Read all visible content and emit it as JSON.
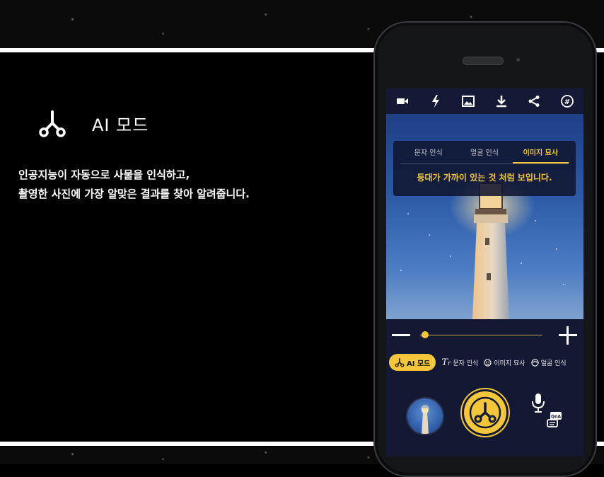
{
  "left_panel": {
    "mode_icon": "ai-mode-icon",
    "mode_title": "AI 모드",
    "description_lines": [
      "인공지능이 자동으로 사물을 인식하고,",
      "촬영한 사진에 가장 알맞은 결과를 찾아 알려줍니다."
    ]
  },
  "phone": {
    "toolbar_icons": [
      "video-camera-icon",
      "flash-icon",
      "gallery-icon",
      "download-icon",
      "share-icon",
      "hashtag-icon"
    ],
    "recognition_tabs": [
      {
        "label": "문자 인식",
        "active": false
      },
      {
        "label": "얼굴 인식",
        "active": false
      },
      {
        "label": "이미지 묘사",
        "active": true
      }
    ],
    "caption": "등대가 가까이 있는 것 처럼 보입니다.",
    "zoom_level": 0.04,
    "modes": [
      {
        "label": "AI 모드",
        "icon": "ai-mode-icon",
        "active": true
      },
      {
        "label": "문자 인식",
        "icon": "text-recognition-icon",
        "active": false
      },
      {
        "label": "이미지 묘사",
        "icon": "image-description-icon",
        "active": false
      },
      {
        "label": "얼굴 인식",
        "icon": "face-recognition-icon",
        "active": false
      }
    ],
    "bottom_controls": {
      "thumbnail": "last-photo-thumbnail",
      "shutter": "ai-shutter-button",
      "voice": "microphone-icon",
      "qna": "qna-icon"
    }
  },
  "colors": {
    "accent": "#f3c63b",
    "screen_bg": "#131833",
    "page_bg": "#000000"
  }
}
